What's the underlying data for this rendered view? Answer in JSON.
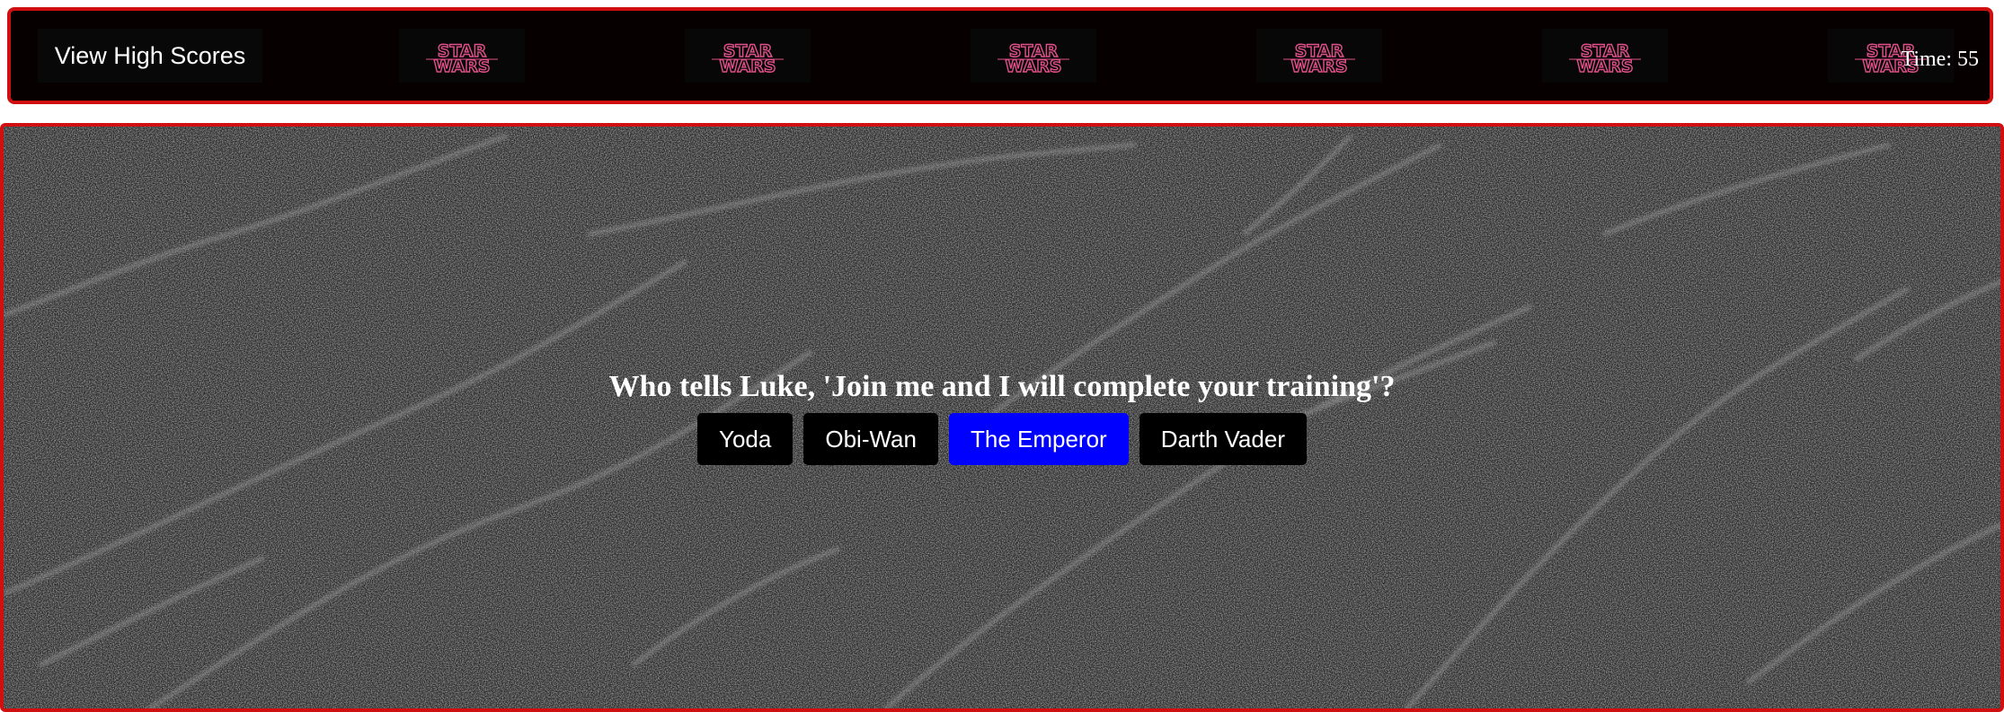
{
  "header": {
    "high_scores_label": "View High Scores",
    "logo_text_top": "STAR",
    "logo_text_bottom": "WARS",
    "logo_count": 6,
    "timer_label": "Time: 55"
  },
  "quiz": {
    "question": "Who tells Luke, 'Join me and I will complete your training'?",
    "answers": [
      {
        "label": "Yoda",
        "state": "normal"
      },
      {
        "label": "Obi-Wan",
        "state": "normal"
      },
      {
        "label": "The Emperor",
        "state": "hover"
      },
      {
        "label": "Darth Vader",
        "state": "normal"
      }
    ]
  },
  "colors": {
    "border": "#d01010",
    "header_bg": "#060000",
    "hover_button": "#0000ff",
    "button": "#000000",
    "logo_pink": "#e0508a"
  }
}
